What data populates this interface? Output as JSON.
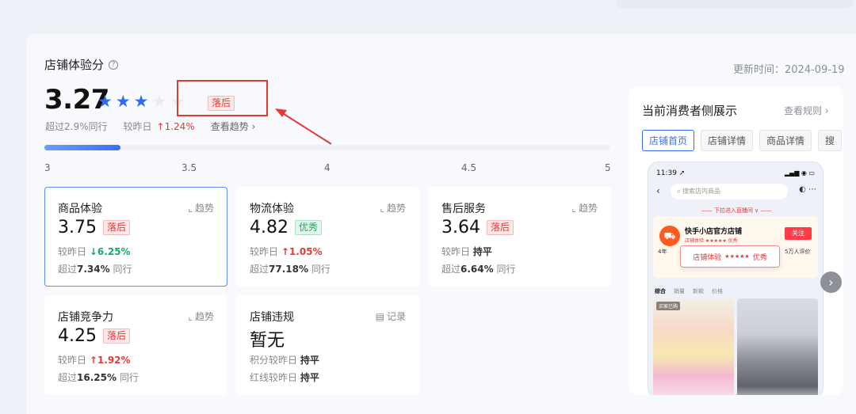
{
  "header": {
    "title": "店铺体验分",
    "help_icon": "question-circle-icon",
    "update_label": "更新时间：2024-09-19"
  },
  "overall": {
    "score": "3.27",
    "stars_filled": 3,
    "stars_total": 5,
    "status_badge": "落后",
    "exceed_text": "超过2.9%同行",
    "vs_label": "较昨日",
    "vs_arrow": "↑",
    "vs_value": "1.24%",
    "trend_link": "查看趋势 ›",
    "progress_fraction": 0.135,
    "ticks": [
      "3",
      "3.5",
      "4",
      "4.5",
      "5"
    ]
  },
  "metrics": [
    {
      "title": "商品体验",
      "action": "趋势",
      "action_icon": "chart-line-icon",
      "value": "3.75",
      "badge": "落后",
      "badge_type": "bad",
      "vs_label": "较昨日",
      "vs_arrow": "↓",
      "vs_value": "6.25%",
      "vs_color": "green",
      "exceed_prefix": "超过",
      "exceed_value": "7.34%",
      "exceed_suffix": "同行"
    },
    {
      "title": "物流体验",
      "action": "趋势",
      "action_icon": "chart-line-icon",
      "value": "4.82",
      "badge": "优秀",
      "badge_type": "good",
      "vs_label": "较昨日",
      "vs_arrow": "↑",
      "vs_value": "1.05%",
      "vs_color": "red",
      "exceed_prefix": "超过",
      "exceed_value": "77.18%",
      "exceed_suffix": "同行"
    },
    {
      "title": "售后服务",
      "action": "趋势",
      "action_icon": "chart-line-icon",
      "value": "3.64",
      "badge": "落后",
      "badge_type": "bad",
      "vs_label": "较昨日",
      "vs_arrow": "",
      "vs_value": "持平",
      "vs_color": "plain",
      "exceed_prefix": "超过",
      "exceed_value": "6.64%",
      "exceed_suffix": "同行"
    },
    {
      "title": "店铺竞争力",
      "action": "趋势",
      "action_icon": "chart-line-icon",
      "value": "4.25",
      "badge": "落后",
      "badge_type": "bad",
      "vs_label": "较昨日",
      "vs_arrow": "↑",
      "vs_value": "1.92%",
      "vs_color": "red",
      "exceed_prefix": "超过",
      "exceed_value": "16.25%",
      "exceed_suffix": "同行"
    },
    {
      "title": "店铺违规",
      "action": "记录",
      "action_icon": "document-icon",
      "value": "暂无",
      "line1_label": "积分较昨日",
      "line1_value": "持平",
      "line2_label": "红线较昨日",
      "line2_value": "持平"
    }
  ],
  "preview": {
    "title": "当前消费者侧展示",
    "rule_link": "查看规则 ›",
    "tabs": [
      "店铺首页",
      "店铺详情",
      "商品详情",
      "搜"
    ],
    "active_tab": 0,
    "phone": {
      "time": "11:39 ➚",
      "search_placeholder": "搜索店内商品",
      "enter_text": "下拉进入直播间",
      "shop_name": "快手小店官方店铺",
      "shop_sub": "店铺体验 ★★★★★ 优秀",
      "follow": "关注",
      "popup_label": "店铺体验",
      "popup_stars": "★★★★★",
      "popup_level": "优秀",
      "side_left": "4年",
      "side_right": "5万人评价",
      "tabs": [
        "综合",
        "销量",
        "新款",
        "价格"
      ],
      "img_tag": "买家已购"
    }
  }
}
